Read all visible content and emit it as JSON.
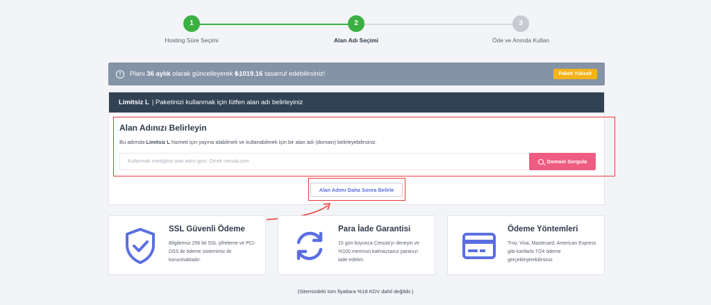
{
  "stepper": {
    "steps": [
      {
        "number": "1",
        "label": "Hosting Süre Seçimi"
      },
      {
        "number": "2",
        "label": "Alan Adı Seçimi"
      },
      {
        "number": "3",
        "label": "Öde ve Anında Kullan"
      }
    ]
  },
  "banner": {
    "icon": "info-icon",
    "text_before": "Planı ",
    "duration": "36 aylık",
    "text_middle": " olarak güncelleyerek ",
    "amount": "₺1019.16",
    "text_after": " tasarruf edebilirsiniz!",
    "upgrade_label": "Paketi Yükselt"
  },
  "card": {
    "header_plan": "Limitsiz L",
    "header_text": "| Paketinizi kullanmak için lütfen alan adı belirleyiniz",
    "domain_title": "Alan Adınızı Belirleyin",
    "desc_before": "Bu adımda ",
    "desc_plan": "Limitsiz L",
    "desc_after": " hizmeti için yayına alabilmek ve kullanabilmek için bir alan adı (domain) belirleyebilirsiniz.",
    "search_placeholder": "Kullanmak istediğiniz alan adını girin. Örnek cenuta.com",
    "search_button": "Domain Sorgula",
    "later_button": "Alan Adımı Daha Sonra Belirle"
  },
  "features": [
    {
      "icon": "shield-check-icon",
      "title": "SSL Güvenli Ödeme",
      "desc": "Bilgileriniz 256 bit SSL şifreleme ve PCI-DSS ile ödeme sistemimiz ile korunmaktadır."
    },
    {
      "icon": "refresh-icon",
      "title": "Para İade Garantisi",
      "desc": "15 gün boyunca Cenuta'yı deneyin ve %100 memnun kalmazsanız paranızı iade edelim."
    },
    {
      "icon": "credit-card-icon",
      "title": "Ödeme Yöntemleri",
      "desc": "Troy, Visa, Mastecard, American Express gibi kartlarla 7/24 ödeme gerçekleştirebilirsiniz."
    }
  ],
  "footnote": "(Sitemizdeki tüm fiyatlara %18 KDV dahil değildir.)",
  "colors": {
    "accent_green": "#3cb043",
    "banner_bg": "#8493a6",
    "header_bg": "#324255",
    "search_btn": "#ef5c82",
    "upgrade_btn": "#f4b31b",
    "icon_blue": "#5b6ee1",
    "highlight_red": "#e53935"
  }
}
